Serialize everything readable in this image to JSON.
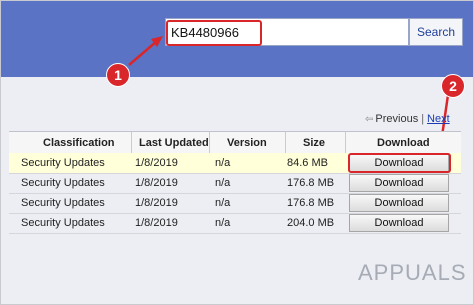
{
  "search": {
    "value": "KB4480966",
    "button_label": "Search"
  },
  "annotations": {
    "step1": "1",
    "step2": "2"
  },
  "pager": {
    "previous": "Previous",
    "separator": "|",
    "next": "Next"
  },
  "table": {
    "columns": [
      "Classification",
      "Last Updated",
      "Version",
      "Size",
      "Download"
    ],
    "rows": [
      {
        "classification": "Security Updates",
        "last_updated": "1/8/2019",
        "version": "n/a",
        "size": "84.6 MB",
        "download": "Download"
      },
      {
        "classification": "Security Updates",
        "last_updated": "1/8/2019",
        "version": "n/a",
        "size": "176.8 MB",
        "download": "Download"
      },
      {
        "classification": "Security Updates",
        "last_updated": "1/8/2019",
        "version": "n/a",
        "size": "176.8 MB",
        "download": "Download"
      },
      {
        "classification": "Security Updates",
        "last_updated": "1/8/2019",
        "version": "n/a",
        "size": "204.0 MB",
        "download": "Download"
      }
    ]
  },
  "watermark": "APPUALS",
  "colors": {
    "header_bar": "#5b73c4",
    "annotation_red": "#d9262b",
    "selected_row": "#ffffd9",
    "link_blue": "#1a3bb3"
  }
}
